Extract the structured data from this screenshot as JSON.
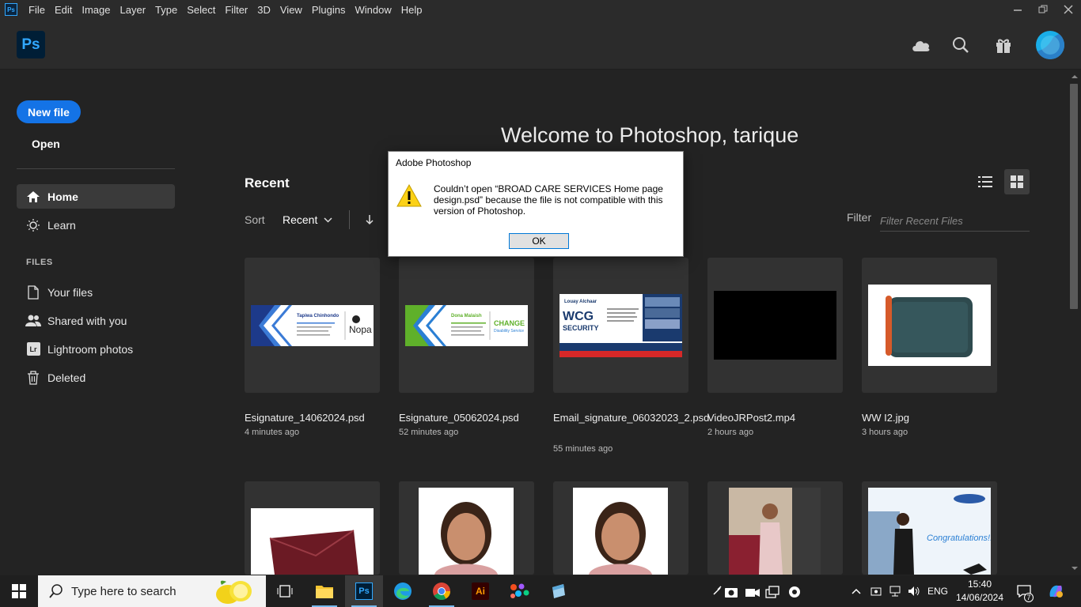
{
  "menubar": {
    "app_icon": "Ps",
    "items": [
      "File",
      "Edit",
      "Image",
      "Layer",
      "Type",
      "Select",
      "Filter",
      "3D",
      "View",
      "Plugins",
      "Window",
      "Help"
    ],
    "window_controls": [
      "minimize-icon",
      "restore-icon",
      "close-icon"
    ]
  },
  "header": {
    "logo": "Ps",
    "icons": [
      "cloud-icon",
      "search-icon",
      "gift-icon"
    ]
  },
  "sidebar": {
    "new_file": "New file",
    "open": "Open",
    "nav": [
      {
        "label": "Home",
        "icon": "home-icon",
        "active": true
      },
      {
        "label": "Learn",
        "icon": "lightbulb-icon",
        "active": false
      }
    ],
    "files_header": "FILES",
    "files": [
      {
        "label": "Your files",
        "icon": "document-icon"
      },
      {
        "label": "Shared with you",
        "icon": "people-icon"
      },
      {
        "label": "Lightroom photos",
        "icon": "lightroom-icon",
        "badge": "Lr"
      },
      {
        "label": "Deleted",
        "icon": "trash-icon"
      }
    ]
  },
  "main": {
    "welcome": "Welcome to Photoshop, tarique",
    "recent_title": "Recent",
    "sort_label": "Sort",
    "sort_value": "Recent",
    "filter_label": "Filter",
    "filter_placeholder": "Filter Recent Files",
    "files": [
      {
        "name": "Esignature_14062024.psd",
        "time": "4 minutes ago",
        "thumb_text_1": "Tapiwa Chinhondo",
        "thumb_text_2": "Nopa"
      },
      {
        "name": "Esignature_05062024.psd",
        "time": "52 minutes ago",
        "thumb_text_1": "Dona Malaish",
        "thumb_text_2": "CHANGE",
        "thumb_text_3": "Disability Service"
      },
      {
        "name": "Email_signature_06032023_2.psd",
        "time": "55 minutes ago",
        "thumb_text_1": "Louay Alchaar",
        "thumb_text_2": "WCG",
        "thumb_text_3": "SECURITY"
      },
      {
        "name": "VideoJRPost2.mp4",
        "time": "2 hours ago"
      },
      {
        "name": "WW I2.jpg",
        "time": "3 hours ago"
      }
    ],
    "row2_thumb_text": "Congratulations!!!"
  },
  "dialog": {
    "title": "Adobe Photoshop",
    "message": "Couldn’t open “BROAD CARE SERVICES Home page design.psd” because the file is not compatible with this version of Photoshop.",
    "ok": "OK"
  },
  "taskbar": {
    "search_placeholder": "Type here to search",
    "apps": [
      "task-view-icon",
      "file-explorer-icon",
      "photoshop-icon",
      "edge-icon",
      "chrome-icon",
      "illustrator-icon",
      "figma-icon",
      "notepad-icon"
    ],
    "lang": "ENG",
    "time": "15:40",
    "date": "14/06/2024",
    "notification_count": "7",
    "illustrator_badge": "Ai",
    "photoshop_badge": "Ps"
  }
}
